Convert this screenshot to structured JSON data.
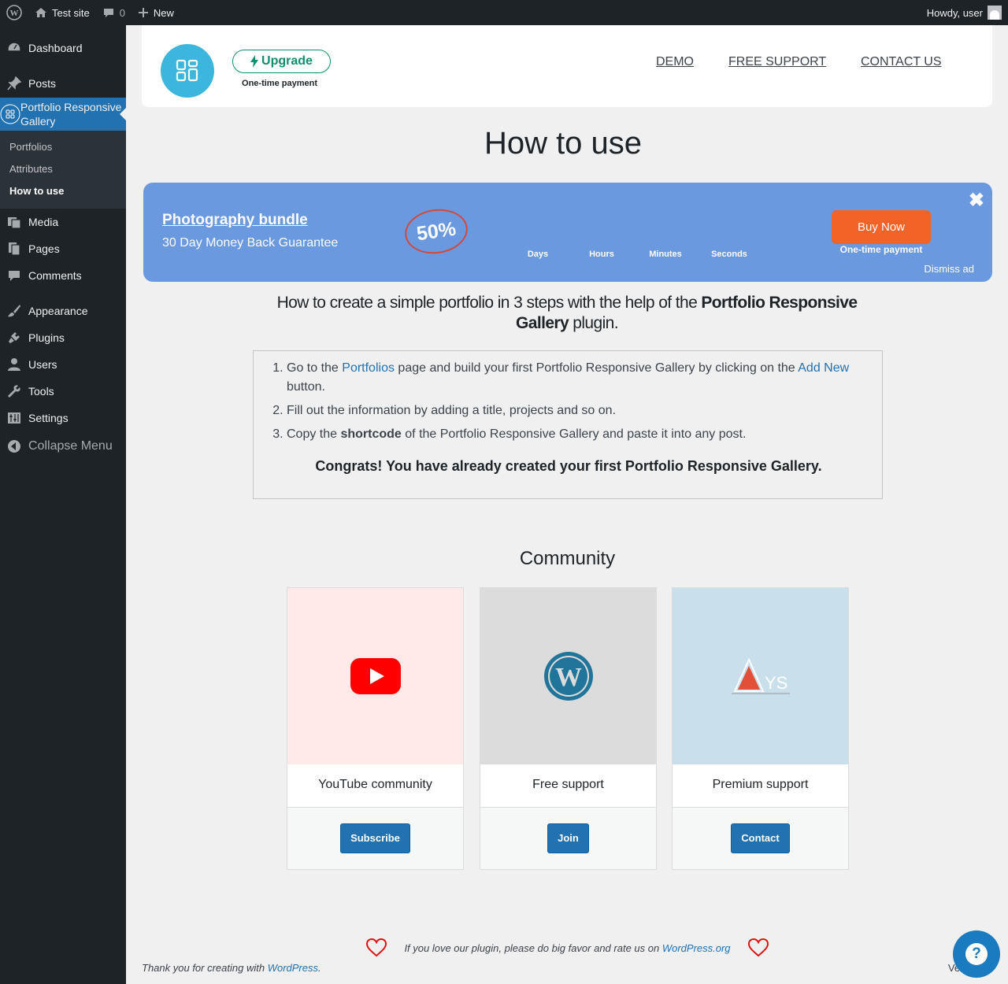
{
  "adminbar": {
    "site_name": "Test site",
    "comments_count": "0",
    "new_label": "New",
    "howdy": "Howdy, user"
  },
  "sidebar": {
    "items": [
      {
        "label": "Dashboard",
        "icon": "dashboard-icon"
      },
      {
        "label": "Posts",
        "icon": "pin-icon"
      },
      {
        "label": "Portfolio Responsive Gallery",
        "icon": "grid-icon"
      },
      {
        "label": "Media",
        "icon": "media-icon"
      },
      {
        "label": "Pages",
        "icon": "pages-icon"
      },
      {
        "label": "Comments",
        "icon": "comment-icon"
      },
      {
        "label": "Appearance",
        "icon": "brush-icon"
      },
      {
        "label": "Plugins",
        "icon": "plugin-icon"
      },
      {
        "label": "Users",
        "icon": "user-icon"
      },
      {
        "label": "Tools",
        "icon": "wrench-icon"
      },
      {
        "label": "Settings",
        "icon": "settings-icon"
      }
    ],
    "submenu": [
      "Portfolios",
      "Attributes",
      "How to use"
    ],
    "collapse": "Collapse Menu"
  },
  "header": {
    "upgrade": "Upgrade",
    "one_time": "One-time payment",
    "links": [
      "DEMO",
      "FREE SUPPORT",
      "CONTACT US"
    ]
  },
  "page_title": "How to use",
  "promo": {
    "title": "Photography bundle",
    "subtitle": "30 Day Money Back Guarantee",
    "badge": "50%",
    "countdown_labels": [
      "Days",
      "Hours",
      "Minutes",
      "Seconds"
    ],
    "buy": "Buy Now",
    "buy_note": "One-time payment",
    "dismiss": "Dismiss ad",
    "colors": {
      "background": "#6a99e0",
      "button": "#f16327"
    }
  },
  "intro": {
    "prefix": "How to create a simple portfolio in 3 steps with the help of the ",
    "plugin": "Portfolio Responsive Gallery",
    "suffix": " plugin."
  },
  "steps": {
    "s1_a": "Go to the ",
    "s1_link1": "Portfolios",
    "s1_b": " page and build your first Portfolio Responsive Gallery by clicking on the ",
    "s1_link2": "Add New",
    "s1_c": " button.",
    "s2": "Fill out the information by adding a title, projects and so on.",
    "s3_a": "Copy the ",
    "s3_bold": "shortcode",
    "s3_b": " of the Portfolio Responsive Gallery and paste it into any post.",
    "congrats": "Congrats! You have already created your first Portfolio Responsive Gallery."
  },
  "community": {
    "title": "Community",
    "cards": [
      {
        "title": "YouTube community",
        "button": "Subscribe",
        "icon": "youtube-icon",
        "bg": "#ffe9e9"
      },
      {
        "title": "Free support",
        "button": "Join",
        "icon": "wordpress-icon",
        "bg": "#dcdcdc"
      },
      {
        "title": "Premium support",
        "button": "Contact",
        "icon": "ays-logo",
        "bg": "#c9e0ec"
      }
    ]
  },
  "footer": {
    "love_text": "If you love our plugin, please do big favor and rate us on ",
    "love_link": "WordPress.org",
    "thanks_prefix": "Thank you for creating with ",
    "thanks_link": "WordPress",
    "thanks_suffix": ".",
    "version": "Versio"
  }
}
